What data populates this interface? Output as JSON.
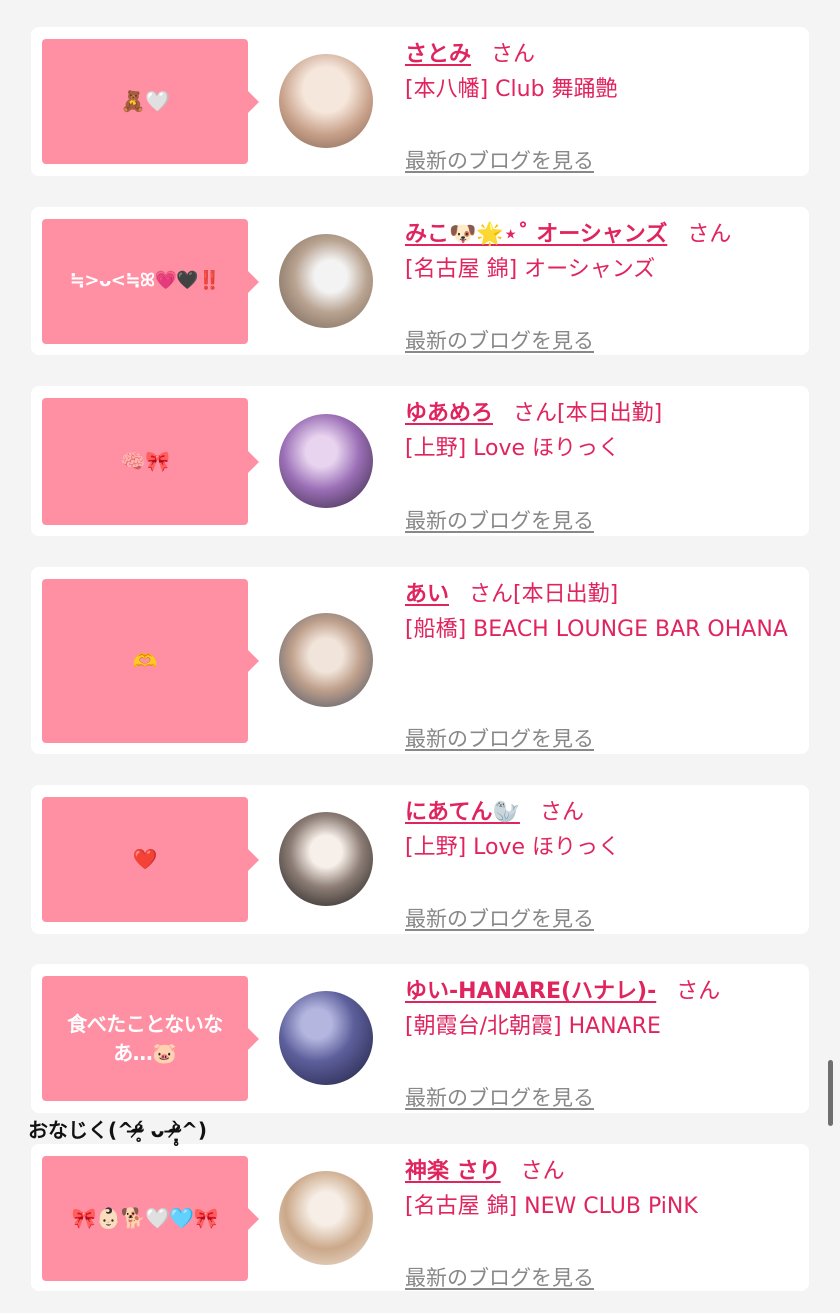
{
  "cards": [
    {
      "comment": "🧸🤍",
      "name": "さとみ",
      "suffix": "さん",
      "shop": "[本八幡] Club 舞踊艶",
      "blog_link": "最新のブログを見る",
      "avatar_colors": [
        "#e9d8cc",
        "#b99882"
      ]
    },
    {
      "comment": "≒>ᴗ<≒ꕤ💗🖤‼️",
      "name": "みこ🐶🌟⋆˚ オーシャンズ",
      "suffix": "さん",
      "shop": "[名古屋 錦] オーシャンズ",
      "blog_link": "最新のブログを見る",
      "avatar_colors": [
        "#c7b5a1",
        "#7e6d5f"
      ]
    },
    {
      "comment": "🧠🎀",
      "name": "ゆあめろ",
      "suffix": "さん[本日出勤]",
      "shop": "[上野] Love ほりっく",
      "blog_link": "最新のブログを見る",
      "avatar_colors": [
        "#c095d6",
        "#3a2a45"
      ]
    },
    {
      "comment": "🫶",
      "name": "あい",
      "suffix": "さん[本日出勤]",
      "shop": "[船橋] BEACH LOUNGE BAR OHANA",
      "blog_link": "最新のブログを見る",
      "avatar_colors": [
        "#d6c9bf",
        "#4b5d73"
      ]
    },
    {
      "comment": "❤️",
      "name": "にあてん🦭",
      "suffix": "さん",
      "shop": "[上野] Love ほりっく",
      "blog_link": "最新のブログを見る",
      "avatar_colors": [
        "#efe6df",
        "#1c1c1c"
      ]
    },
    {
      "comment": "食べたことないなあ…🐷",
      "name": "ゆい-HANARE(ハナレ)-",
      "suffix": "さん",
      "shop": "[朝霞台/北朝霞] HANARE",
      "blog_link": "最新のブログを見る",
      "avatar_colors": [
        "#6d6fae",
        "#1a1b3a"
      ]
    },
    {
      "comment": "🎀👶🏻🐕🤍🩵🎀",
      "name": "神楽 さり",
      "suffix": "さん",
      "shop": "[名古屋 錦] NEW CLUB PiNK",
      "blog_link": "最新のブログを見る",
      "avatar_colors": [
        "#f3ece6",
        "#c9a27f"
      ]
    }
  ],
  "floating_text": "おなじく(^ᵒ̴̶̷̥́ ᴗ ᵒ̴̶̷̣̥̀^)"
}
